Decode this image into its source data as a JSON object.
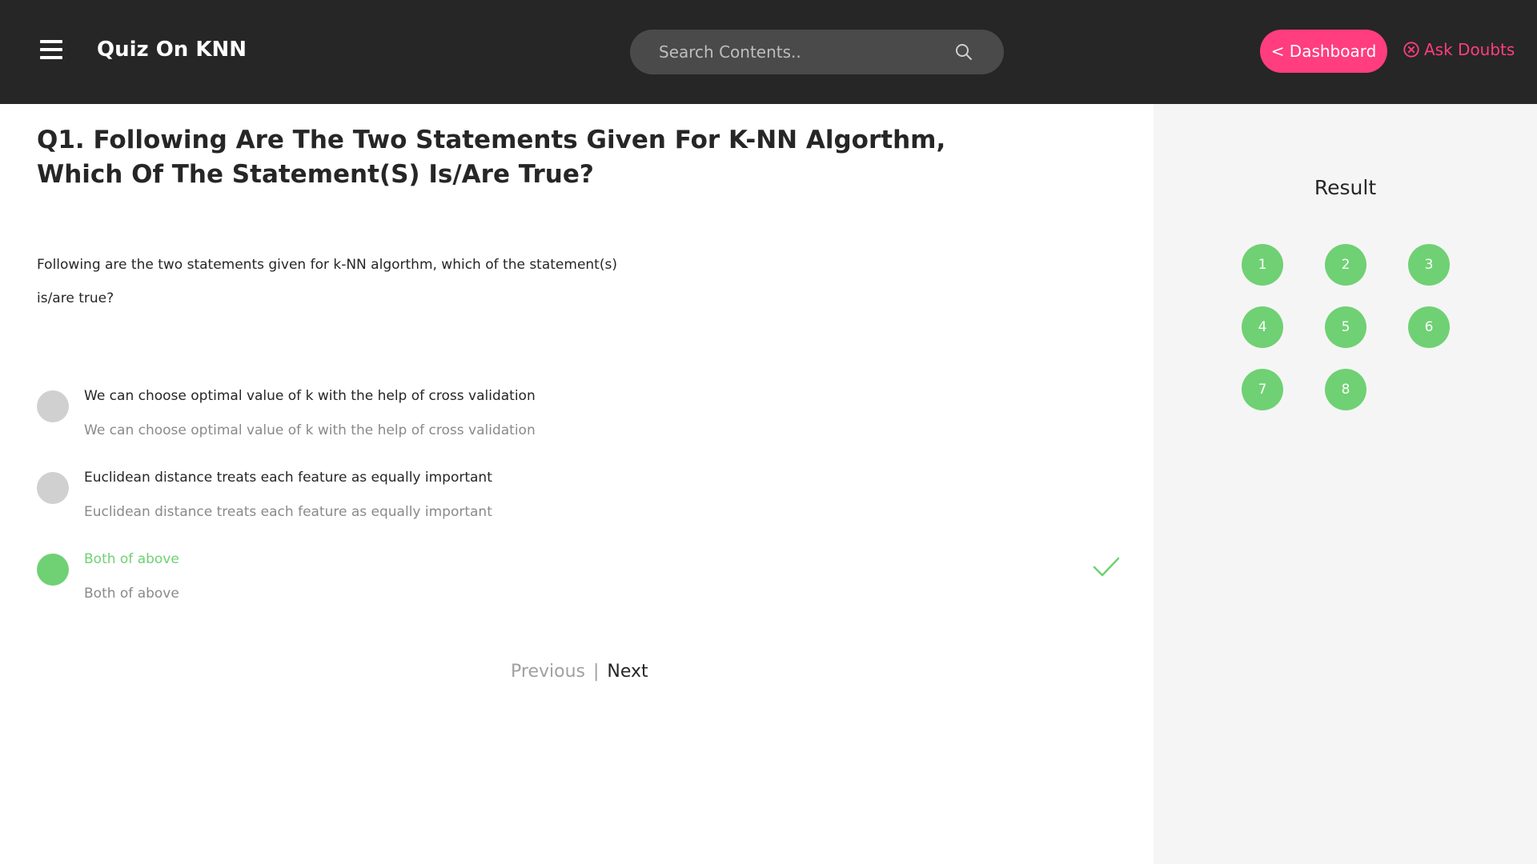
{
  "header": {
    "menu_icon": "hamburger-menu-icon",
    "title": "Quiz On KNN",
    "search": {
      "placeholder": "Search Contents..",
      "value": "",
      "icon": "search-icon"
    },
    "dashboard_label": "< Dashboard",
    "ask_doubts_label": "Ask Doubts",
    "ask_doubts_icon": "close-circle-icon"
  },
  "question": {
    "title": "Q1. Following Are The Two Statements Given For K-NN Algorthm, Which Of The Statement(S) Is/Are True?",
    "body": "Following are the two statements given for k-NN algorthm, which of the statement(s) is/are true?",
    "options": [
      {
        "label": "We can choose optimal value of k with the help of cross validation",
        "sub": "We can choose optimal value of k with the help of cross validation",
        "correct": false
      },
      {
        "label": "Euclidean distance treats each feature as equally important",
        "sub": "Euclidean distance treats each feature as equally important",
        "correct": false
      },
      {
        "label": "Both of above",
        "sub": "Both of above",
        "correct": true
      }
    ]
  },
  "pager": {
    "previous": "Previous",
    "separator": "|",
    "next": "Next"
  },
  "sidebar": {
    "title": "Result",
    "questions": [
      "1",
      "2",
      "3",
      "4",
      "5",
      "6",
      "7",
      "8"
    ]
  },
  "colors": {
    "topbar": "#262626",
    "accent_pink": "#ff3d7f",
    "correct_green": "#6fd173",
    "sidebar_bg": "#f5f5f5"
  }
}
